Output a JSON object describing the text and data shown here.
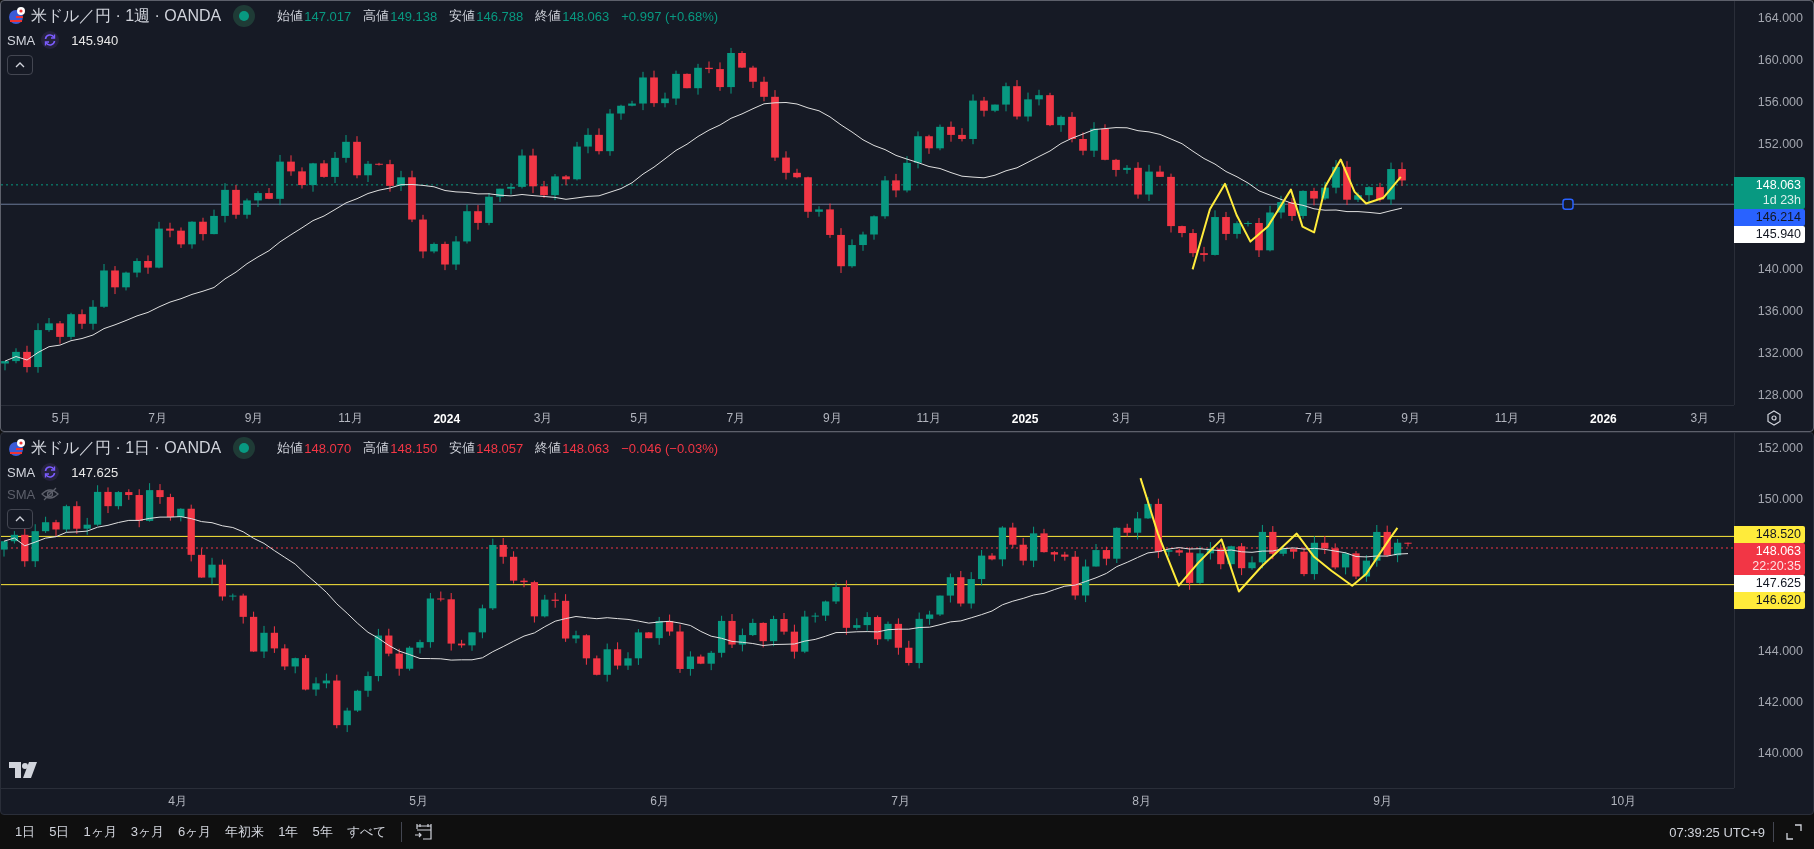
{
  "panes": [
    {
      "legend": {
        "symbol": "米ドル／円 · 1週 · OANDA",
        "rising": true,
        "ohlc": [
          {
            "label": "始値",
            "value": "147.017"
          },
          {
            "label": "高値",
            "value": "149.138"
          },
          {
            "label": "安値",
            "value": "146.788"
          },
          {
            "label": "終値",
            "value": "148.063"
          }
        ],
        "change": "+0.997 (+0.68%)"
      },
      "indicators": [
        {
          "name": "SMA",
          "value": "145.940",
          "hidden": false
        }
      ],
      "price_axis": [
        "164.000",
        "160.000",
        "156.000",
        "152.000",
        "140.000",
        "136.000",
        "132.000",
        "128.000"
      ],
      "time_axis": [
        {
          "label": "5月",
          "kind": "month"
        },
        {
          "label": "7月",
          "kind": "month"
        },
        {
          "label": "9月",
          "kind": "month"
        },
        {
          "label": "11月",
          "kind": "month"
        },
        {
          "label": "2024",
          "kind": "year"
        },
        {
          "label": "3月",
          "kind": "month"
        },
        {
          "label": "5月",
          "kind": "month"
        },
        {
          "label": "7月",
          "kind": "month"
        },
        {
          "label": "9月",
          "kind": "month"
        },
        {
          "label": "11月",
          "kind": "month"
        },
        {
          "label": "2025",
          "kind": "year"
        },
        {
          "label": "3月",
          "kind": "month"
        },
        {
          "label": "5月",
          "kind": "month"
        },
        {
          "label": "7月",
          "kind": "month"
        },
        {
          "label": "9月",
          "kind": "month"
        },
        {
          "label": "11月",
          "kind": "month"
        },
        {
          "label": "2026",
          "kind": "year"
        },
        {
          "label": "3月",
          "kind": "month"
        }
      ],
      "badges": [
        {
          "kind": "last",
          "value": "148.063",
          "countdown": "1d 23h",
          "color": "#089981"
        },
        {
          "kind": "line",
          "value": "146.214",
          "color": "#2962ff"
        },
        {
          "kind": "sma",
          "value": "145.940",
          "color": "#ffffff"
        }
      ]
    },
    {
      "legend": {
        "symbol": "米ドル／円 · 1日 · OANDA",
        "rising": false,
        "ohlc": [
          {
            "label": "始値",
            "value": "148.070"
          },
          {
            "label": "高値",
            "value": "148.150"
          },
          {
            "label": "安値",
            "value": "148.057"
          },
          {
            "label": "終値",
            "value": "148.063"
          }
        ],
        "change": "−0.046 (−0.03%)"
      },
      "indicators": [
        {
          "name": "SMA",
          "value": "147.625",
          "hidden": false
        },
        {
          "name": "SMA",
          "hidden": true
        }
      ],
      "price_axis": [
        "152.000",
        "150.000",
        "144.000",
        "142.000",
        "140.000"
      ],
      "time_axis": [
        {
          "label": "4月",
          "kind": "month"
        },
        {
          "label": "5月",
          "kind": "month"
        },
        {
          "label": "6月",
          "kind": "month"
        },
        {
          "label": "7月",
          "kind": "month"
        },
        {
          "label": "8月",
          "kind": "month"
        },
        {
          "label": "9月",
          "kind": "month"
        },
        {
          "label": "10月",
          "kind": "month"
        }
      ],
      "badges": [
        {
          "kind": "line",
          "value": "148.520",
          "color": "#ffeb3b"
        },
        {
          "kind": "last",
          "value": "148.063",
          "countdown": "22:20:35",
          "color": "#f23645"
        },
        {
          "kind": "sma",
          "value": "147.625",
          "color": "#ffffff"
        },
        {
          "kind": "line",
          "value": "146.620",
          "color": "#ffeb3b"
        }
      ]
    }
  ],
  "bottom_bar": {
    "ranges": [
      "1日",
      "5日",
      "1ヶ月",
      "3ヶ月",
      "6ヶ月",
      "年初来",
      "1年",
      "5年",
      "すべて"
    ],
    "clock": "07:39:25 UTC+9"
  }
}
